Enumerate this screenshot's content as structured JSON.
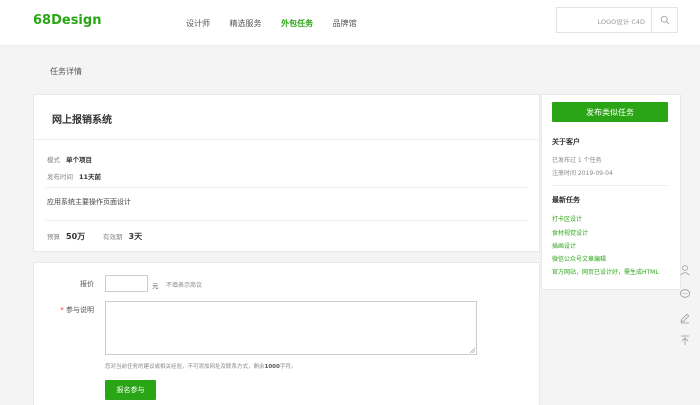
{
  "header": {
    "logo": "68Design",
    "nav": [
      {
        "label": "设计师",
        "active": false
      },
      {
        "label": "精选服务",
        "active": false
      },
      {
        "label": "外包任务",
        "active": true
      },
      {
        "label": "品牌馆",
        "active": false
      }
    ],
    "search_hint": "LOGO设计  C4D"
  },
  "page_heading": "任务详情",
  "task": {
    "title": "网上报销系统",
    "mode_label": "模式",
    "mode_value": "单个项目",
    "published_label": "发布时间",
    "published_value": "11天前",
    "description": "应用系统主要操作页面设计",
    "budget_label": "预算",
    "budget_value": "50万",
    "validity_label": "有效期",
    "validity_value": "3天"
  },
  "form": {
    "price_label": "报价",
    "price_unit": "元",
    "price_note": "不填表示商议",
    "desc_label": "参与说明",
    "hint_prefix": "您对当前任务的建议或相关经验，不可添加网址及联系方式，剩余",
    "hint_count": "1000",
    "hint_suffix": "字符。",
    "submit_label": "报名参与"
  },
  "sidebar": {
    "publish_label": "发布类似任务",
    "about_title": "关于客户",
    "published_count": "已发布过 1 个任务",
    "register_time": "注册时间 2019-09-04",
    "latest_title": "最新任务",
    "latest_tasks": [
      "打卡区设计",
      "食材视觉设计",
      "插画设计",
      "微信公众号文章编辑",
      "官方网站，网页已设计好，需生成HTML"
    ]
  },
  "floatbar": {
    "icons": [
      "user-icon",
      "chat-icon",
      "edit-icon",
      "back-to-top-icon"
    ]
  },
  "colors": {
    "accent": "#2aa515",
    "background": "#f4f4f4"
  }
}
